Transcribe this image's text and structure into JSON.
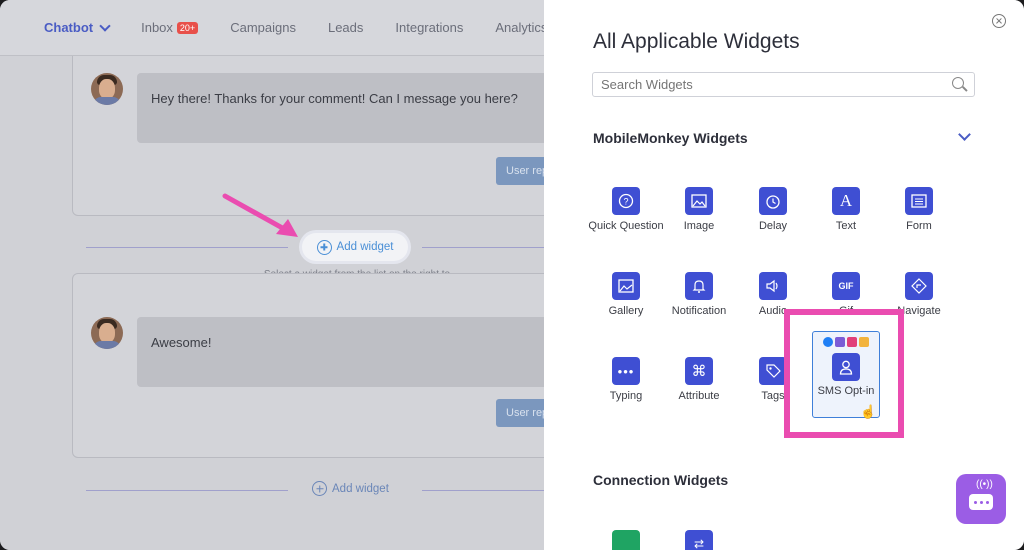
{
  "topnav": {
    "items": [
      {
        "label": "Chatbot"
      },
      {
        "label": "Inbox",
        "badge": "20+"
      },
      {
        "label": "Campaigns"
      },
      {
        "label": "Leads"
      },
      {
        "label": "Integrations"
      },
      {
        "label": "Analytics"
      }
    ]
  },
  "messages": [
    {
      "text": "Hey there! Thanks for your comment! Can I message you here?",
      "reply_label": "User rep"
    },
    {
      "text": "Awesome!",
      "reply_label": "User rep"
    }
  ],
  "add_widget": {
    "label": "Add widget",
    "hint": "Select a widget from the list on the right to add it here",
    "bottom_label": "Add widget"
  },
  "panel": {
    "title": "All Applicable Widgets",
    "search_placeholder": "Search Widgets",
    "section_mm": "MobileMonkey Widgets",
    "section_conn": "Connection Widgets"
  },
  "widgets": [
    {
      "label": "Quick Question",
      "icon": "question-icon"
    },
    {
      "label": "Image",
      "icon": "image-icon"
    },
    {
      "label": "Delay",
      "icon": "clock-icon"
    },
    {
      "label": "Text",
      "icon": "text-icon"
    },
    {
      "label": "Form",
      "icon": "form-icon"
    },
    {
      "label": "Gallery",
      "icon": "gallery-icon"
    },
    {
      "label": "Notification",
      "icon": "bell-icon"
    },
    {
      "label": "Audio",
      "icon": "audio-icon"
    },
    {
      "label": "Gif",
      "icon": "gif-icon"
    },
    {
      "label": "Navigate",
      "icon": "navigate-icon"
    },
    {
      "label": "Typing",
      "icon": "typing-icon"
    },
    {
      "label": "Attribute",
      "icon": "command-icon"
    },
    {
      "label": "Tags",
      "icon": "tag-icon"
    }
  ],
  "sms_widget": {
    "label": "SMS Opt-in",
    "icon": "user-icon"
  },
  "colors": {
    "accent": "#3f4fd3",
    "highlight": "#ea4cb0",
    "fab": "#9b5de5"
  }
}
